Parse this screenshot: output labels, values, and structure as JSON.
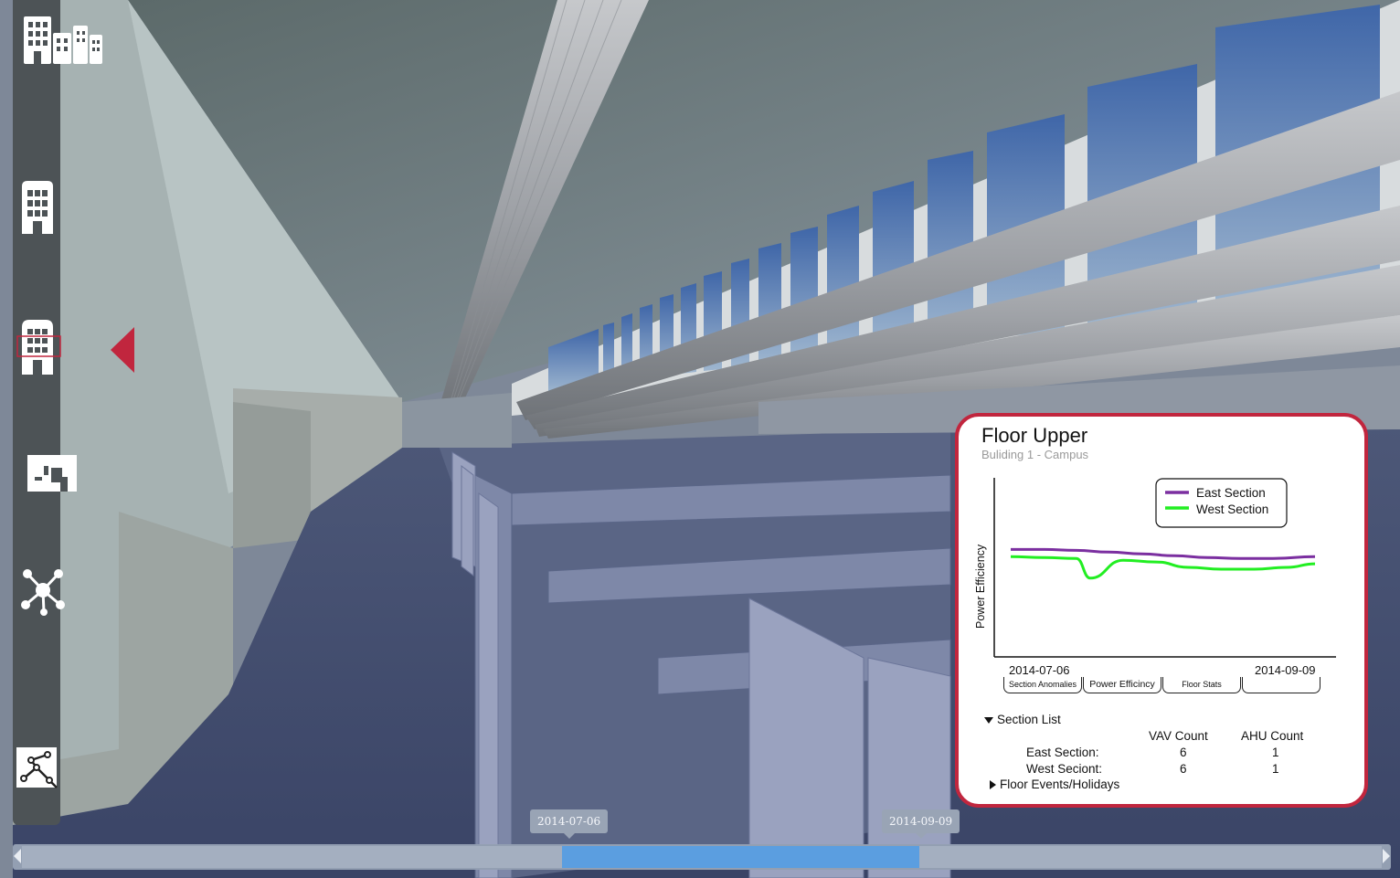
{
  "panel": {
    "title": "Floor Upper",
    "subtitle": "Buliding 1 - Campus",
    "accent_color": "#c1263e",
    "tabs": [
      "Section Anomalies",
      "Power Efficincy",
      "Floor Stats",
      ""
    ],
    "active_tab": "Power Efficincy",
    "section_list": {
      "label": "Section List",
      "expanded": true,
      "columns": [
        "VAV Count",
        "AHU Count"
      ],
      "rows": [
        {
          "name": "East Section:",
          "vav": "6",
          "ahu": "1"
        },
        {
          "name": "West Seciont:",
          "vav": "6",
          "ahu": "1"
        }
      ]
    },
    "events_label": "Floor Events/Holidays",
    "events_expanded": false
  },
  "chart_data": {
    "type": "line",
    "ylabel": "Power Efficiency",
    "xlabel": "",
    "x_start": "2014-07-06",
    "x_end": "2014-09-09",
    "x_tick_labels": [
      "2014-07-06",
      "2014-09-09"
    ],
    "ylim": [
      0,
      1
    ],
    "grid": false,
    "legend_position": "top-right",
    "series": [
      {
        "name": "East Section",
        "color": "#7b2fa0",
        "x": [
          "2014-07-06",
          "2014-07-13",
          "2014-07-20",
          "2014-07-27",
          "2014-08-03",
          "2014-08-10",
          "2014-08-17",
          "2014-08-24",
          "2014-08-31",
          "2014-09-09"
        ],
        "values": [
          0.6,
          0.6,
          0.595,
          0.585,
          0.575,
          0.565,
          0.555,
          0.55,
          0.55,
          0.56
        ]
      },
      {
        "name": "West Section",
        "color": "#22ee22",
        "x": [
          "2014-07-06",
          "2014-07-13",
          "2014-07-20",
          "2014-07-23",
          "2014-07-30",
          "2014-08-06",
          "2014-08-13",
          "2014-08-20",
          "2014-08-27",
          "2014-09-03",
          "2014-09-09"
        ],
        "values": [
          0.56,
          0.555,
          0.55,
          0.44,
          0.54,
          0.53,
          0.5,
          0.49,
          0.49,
          0.5,
          0.52
        ]
      }
    ]
  },
  "timeline": {
    "start_label": "2014-07-06",
    "end_label": "2014-09-09",
    "range_color": "#5b9ee0"
  },
  "sidebar": {
    "items": [
      {
        "name": "campus-buildings",
        "icon": "buildings-icon"
      },
      {
        "name": "building",
        "icon": "building-icon"
      },
      {
        "name": "floor",
        "icon": "building-floor-icon",
        "active": true
      },
      {
        "name": "floor-plan",
        "icon": "floor-plan-icon"
      },
      {
        "name": "network",
        "icon": "network-icon"
      },
      {
        "name": "path",
        "icon": "path-icon"
      }
    ],
    "active_color": "#c1263e"
  }
}
